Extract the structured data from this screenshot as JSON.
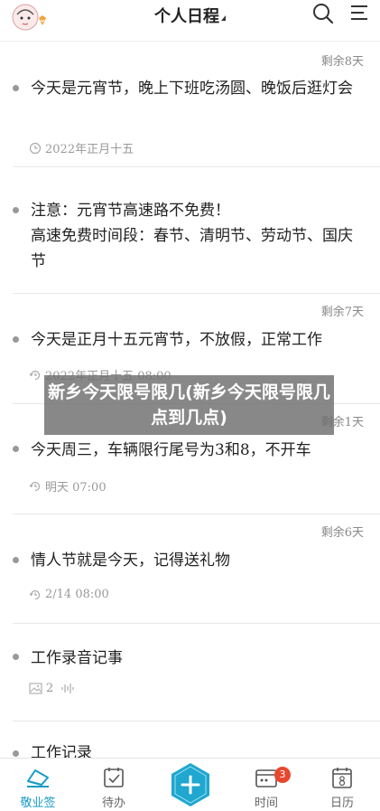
{
  "header": {
    "title": "个人日程"
  },
  "entries": [
    {
      "remaining": "剩余8天",
      "text": "今天是元宵节，晚上下班吃汤圆、晚饭后逛灯会",
      "meta": "2022年正月十五"
    },
    {
      "remaining": "",
      "text": "注意：元宵节高速路不免费！\n高速免费时间段：春节、清明节、劳动节、国庆节",
      "meta": ""
    },
    {
      "remaining": "剩余7天",
      "text": "今天是正月十五元宵节，不放假，正常工作",
      "meta": "2022年正月十五 08:00"
    },
    {
      "remaining": "剩余1天",
      "text": "今天周三，车辆限行尾号为3和8，不开车",
      "meta": "明天 07:00"
    },
    {
      "remaining": "剩余6天",
      "text": "情人节就是今天，记得送礼物",
      "meta": "2/14 08:00"
    },
    {
      "remaining": "",
      "text": "工作录音记事",
      "meta": "2"
    },
    {
      "remaining": "",
      "text": "工作记录",
      "meta": ""
    }
  ],
  "overlay": {
    "text": "新乡今天限号限几(新乡今天限号限几点到几点)"
  },
  "tabbar": {
    "tabs": [
      {
        "label": "敬业签",
        "active": true
      },
      {
        "label": "待办",
        "active": false
      },
      {
        "label": "时间",
        "badge": "3",
        "active": false
      },
      {
        "label": "日历",
        "active": false
      }
    ]
  },
  "colors": {
    "accent": "#1a9cc4",
    "badge": "#e8472f",
    "overlay": "#6e6e6e"
  }
}
